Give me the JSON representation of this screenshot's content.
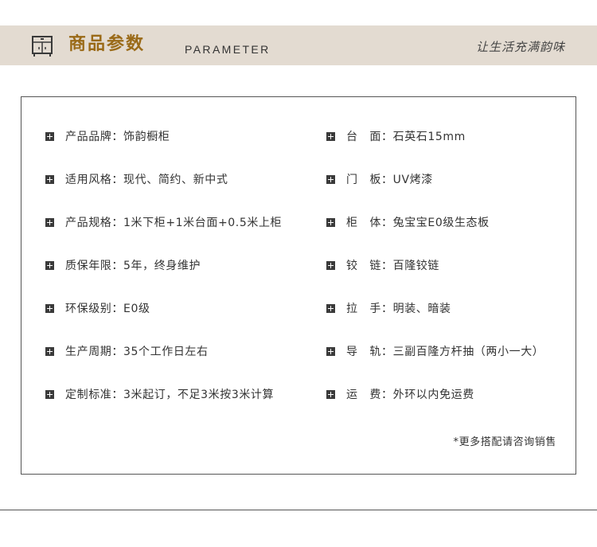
{
  "header": {
    "title_cn": "商品参数",
    "title_en": "PARAMETER",
    "slogan": "让生活充满韵味",
    "icon": "cabinet-icon",
    "band_color": "#e3dbd1",
    "title_color": "#9a6a18"
  },
  "specs_left": [
    {
      "label": "产品品牌",
      "value": "饰韵橱柜"
    },
    {
      "label": "适用风格",
      "value": "现代、简约、新中式"
    },
    {
      "label": "产品规格",
      "value": "1米下柜+1米台面+0.5米上柜"
    },
    {
      "label": "质保年限",
      "value": "5年，终身维护"
    },
    {
      "label": "环保级别",
      "value": "E0级"
    },
    {
      "label": "生产周期",
      "value": "35个工作日左右"
    },
    {
      "label": "定制标准",
      "value": "3米起订，不足3米按3米计算"
    }
  ],
  "specs_right": [
    {
      "label_a": "台",
      "label_b": "面",
      "value": "石英石15mm"
    },
    {
      "label_a": "门",
      "label_b": "板",
      "value": "UV烤漆"
    },
    {
      "label_a": "柜",
      "label_b": "体",
      "value": "兔宝宝E0级生态板"
    },
    {
      "label_a": "铰",
      "label_b": "链",
      "value": "百隆铰链"
    },
    {
      "label_a": "拉",
      "label_b": "手",
      "value": "明装、暗装"
    },
    {
      "label_a": "导",
      "label_b": "轨",
      "value": "三副百隆方杆抽（两小一大）"
    },
    {
      "label_a": "运",
      "label_b": "费",
      "value": "外环以内免运费"
    }
  ],
  "colon": "：",
  "note": "*更多搭配请咨询销售"
}
